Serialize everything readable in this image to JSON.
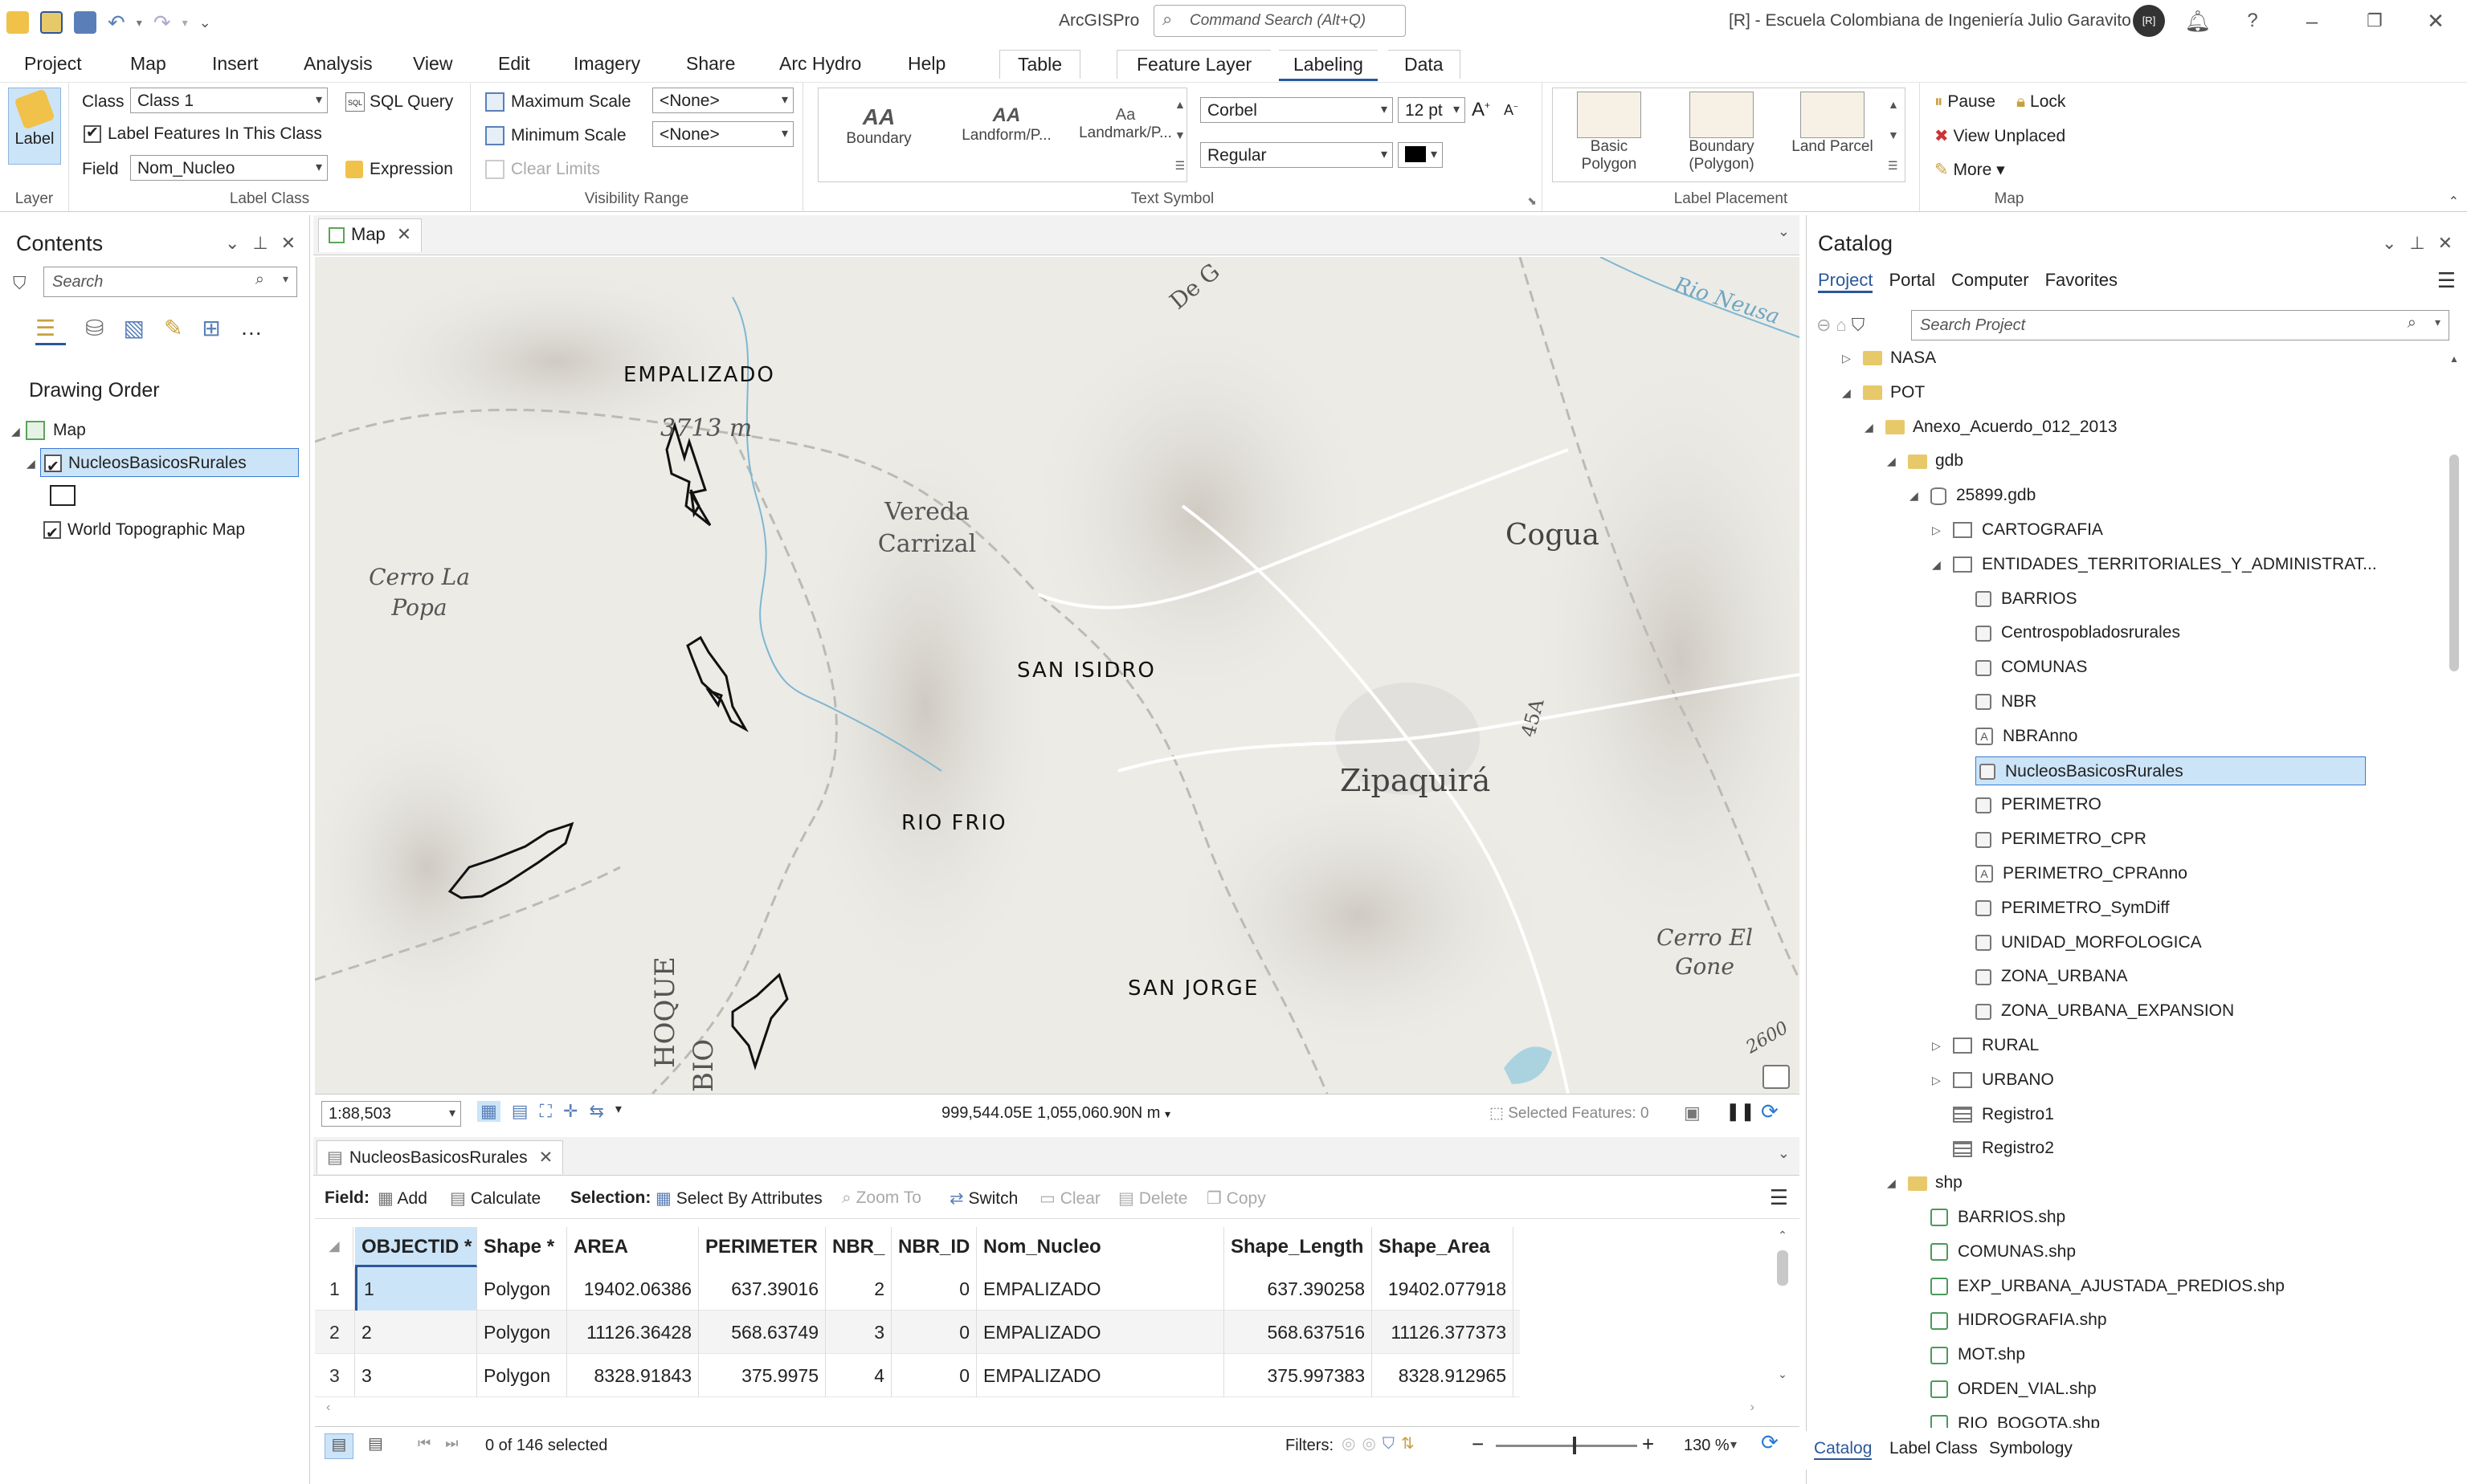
{
  "titlebar": {
    "app_name": "ArcGISPro",
    "command_search_placeholder": "Command Search (Alt+Q)",
    "user_org": "[R] - Escuela Colombiana de Ingeniería Julio Garavito",
    "avatar_text": "[R]"
  },
  "menu": {
    "tabs": [
      "Project",
      "Map",
      "Insert",
      "Analysis",
      "View",
      "Edit",
      "Imagery",
      "Share",
      "Arc Hydro",
      "Help"
    ],
    "contextual": {
      "table": "Table",
      "feature_layer": "Feature Layer",
      "labeling": "Labeling",
      "data": "Data"
    }
  },
  "ribbon": {
    "layer": {
      "button": "Label",
      "group": "Layer"
    },
    "label_class": {
      "class_label": "Class",
      "class_value": "Class 1",
      "sql_query": "SQL Query",
      "label_features": "Label Features In This Class",
      "field_label": "Field",
      "field_value": "Nom_Nucleo",
      "expression": "Expression",
      "group": "Label Class"
    },
    "visibility": {
      "max_scale": "Maximum Scale",
      "max_value": "<None>",
      "min_scale": "Minimum Scale",
      "min_value": "<None>",
      "clear_limits": "Clear Limits",
      "group": "Visibility Range"
    },
    "text_symbol": {
      "gallery": [
        {
          "label": "Boundary",
          "sample": "AA"
        },
        {
          "label": "Landform/P...",
          "sample": "AA"
        },
        {
          "label": "Landmark/P...",
          "sample": "Aa"
        }
      ],
      "font": "Corbel",
      "size": "12 pt",
      "style": "Regular",
      "group": "Text Symbol"
    },
    "label_placement": {
      "items": [
        "Basic Polygon",
        "Boundary (Polygon)",
        "Land Parcel"
      ],
      "group": "Label Placement"
    },
    "map": {
      "pause": "Pause",
      "lock": "Lock",
      "view_unplaced": "View Unplaced",
      "more": "More",
      "group": "Map"
    }
  },
  "contents": {
    "title": "Contents",
    "search_placeholder": "Search",
    "drawing_order": "Drawing Order",
    "map_node": "Map",
    "layers": [
      {
        "name": "NucleosBasicosRurales",
        "checked": true,
        "selected": true
      },
      {
        "name": "World Topographic Map",
        "checked": true,
        "selected": false
      }
    ]
  },
  "map_view": {
    "tab": "Map",
    "feature_labels": [
      "EMPALIZADO",
      "SAN ISIDRO",
      "RIO FRIO",
      "SAN JORGE"
    ],
    "basemap_labels": [
      "3713 m",
      "Vereda Carrizal",
      "Cerro La Popa",
      "Cogua",
      "Zipaquirá",
      "Cerro El Gone",
      "Rio Neusa",
      "2600",
      "45A",
      "De G",
      "HOQUE",
      "BIO"
    ],
    "scale": "1:88,503",
    "coordinates": "999,544.05E 1,055,060.90N m",
    "selected_features": "Selected Features: 0"
  },
  "attribute_table": {
    "tab": "NucleosBasicosRurales",
    "toolbar": {
      "field": "Field:",
      "add": "Add",
      "calculate": "Calculate",
      "selection": "Selection:",
      "select_by_attributes": "Select By Attributes",
      "zoom_to": "Zoom To",
      "switch": "Switch",
      "clear": "Clear",
      "delete": "Delete",
      "copy": "Copy"
    },
    "columns": [
      "OBJECTID *",
      "Shape *",
      "AREA",
      "PERIMETER",
      "NBR_",
      "NBR_ID",
      "Nom_Nucleo",
      "Shape_Length",
      "Shape_Area"
    ],
    "rows": [
      {
        "n": "1",
        "cells": [
          "1",
          "Polygon",
          "19402.06386",
          "637.39016",
          "2",
          "0",
          "EMPALIZADO",
          "637.390258",
          "19402.077918"
        ]
      },
      {
        "n": "2",
        "cells": [
          "2",
          "Polygon",
          "11126.36428",
          "568.63749",
          "3",
          "0",
          "EMPALIZADO",
          "568.637516",
          "11126.377373"
        ]
      },
      {
        "n": "3",
        "cells": [
          "3",
          "Polygon",
          "8328.91843",
          "375.9975",
          "4",
          "0",
          "EMPALIZADO",
          "375.997383",
          "8328.912965"
        ]
      }
    ],
    "selection_status": "0 of 146 selected",
    "filters": "Filters:",
    "zoom": "130 %"
  },
  "catalog": {
    "title": "Catalog",
    "tabs": [
      "Project",
      "Portal",
      "Computer",
      "Favorites"
    ],
    "search_placeholder": "Search Project",
    "tree": [
      {
        "label": "NASA",
        "type": "folder",
        "level": 0,
        "expander": "▷"
      },
      {
        "label": "POT",
        "type": "folder",
        "level": 0,
        "expander": "◢"
      },
      {
        "label": "Anexo_Acuerdo_012_2013",
        "type": "folder",
        "level": 1,
        "expander": "◢"
      },
      {
        "label": "gdb",
        "type": "folder",
        "level": 2,
        "expander": "◢"
      },
      {
        "label": "25899.gdb",
        "type": "gdb",
        "level": 3,
        "expander": "◢"
      },
      {
        "label": "CARTOGRAFIA",
        "type": "dataset",
        "level": 4,
        "expander": "▷"
      },
      {
        "label": "ENTIDADES_TERRITORIALES_Y_ADMINISTRAT...",
        "type": "dataset",
        "level": 4,
        "expander": "◢"
      },
      {
        "label": "BARRIOS",
        "type": "fc",
        "level": 5
      },
      {
        "label": "Centrospobladosrurales",
        "type": "fc",
        "level": 5
      },
      {
        "label": "COMUNAS",
        "type": "fc",
        "level": 5
      },
      {
        "label": "NBR",
        "type": "fc",
        "level": 5
      },
      {
        "label": "NBRAnno",
        "type": "anno",
        "level": 5
      },
      {
        "label": "NucleosBasicosRurales",
        "type": "fc",
        "level": 5,
        "selected": true
      },
      {
        "label": "PERIMETRO",
        "type": "fc",
        "level": 5
      },
      {
        "label": "PERIMETRO_CPR",
        "type": "fc",
        "level": 5
      },
      {
        "label": "PERIMETRO_CPRAnno",
        "type": "anno",
        "level": 5
      },
      {
        "label": "PERIMETRO_SymDiff",
        "type": "fc",
        "level": 5
      },
      {
        "label": "UNIDAD_MORFOLOGICA",
        "type": "fc",
        "level": 5
      },
      {
        "label": "ZONA_URBANA",
        "type": "fc",
        "level": 5
      },
      {
        "label": "ZONA_URBANA_EXPANSION",
        "type": "fc",
        "level": 5
      },
      {
        "label": "RURAL",
        "type": "dataset",
        "level": 4,
        "expander": "▷"
      },
      {
        "label": "URBANO",
        "type": "dataset",
        "level": 4,
        "expander": "▷"
      },
      {
        "label": "Registro1",
        "type": "table",
        "level": 4
      },
      {
        "label": "Registro2",
        "type": "table",
        "level": 4
      },
      {
        "label": "shp",
        "type": "folder",
        "level": 2,
        "expander": "◢"
      },
      {
        "label": "BARRIOS.shp",
        "type": "shp",
        "level": 3
      },
      {
        "label": "COMUNAS.shp",
        "type": "shp",
        "level": 3
      },
      {
        "label": "EXP_URBANA_AJUSTADA_PREDIOS.shp",
        "type": "shp",
        "level": 3
      },
      {
        "label": "HIDROGRAFIA.shp",
        "type": "shpline",
        "level": 3
      },
      {
        "label": "MOT.shp",
        "type": "shp",
        "level": 3
      },
      {
        "label": "ORDEN_VIAL.shp",
        "type": "shpline",
        "level": 3
      },
      {
        "label": "RIO_BOGOTA.shp",
        "type": "shpline",
        "level": 3
      }
    ],
    "bottom_tabs": [
      "Catalog",
      "Label Class",
      "Symbology"
    ]
  },
  "colors": {
    "accent": "#2b579a",
    "selection": "#cce4f7",
    "folder": "#e8c96a",
    "map_bg": "#ecebe6"
  }
}
